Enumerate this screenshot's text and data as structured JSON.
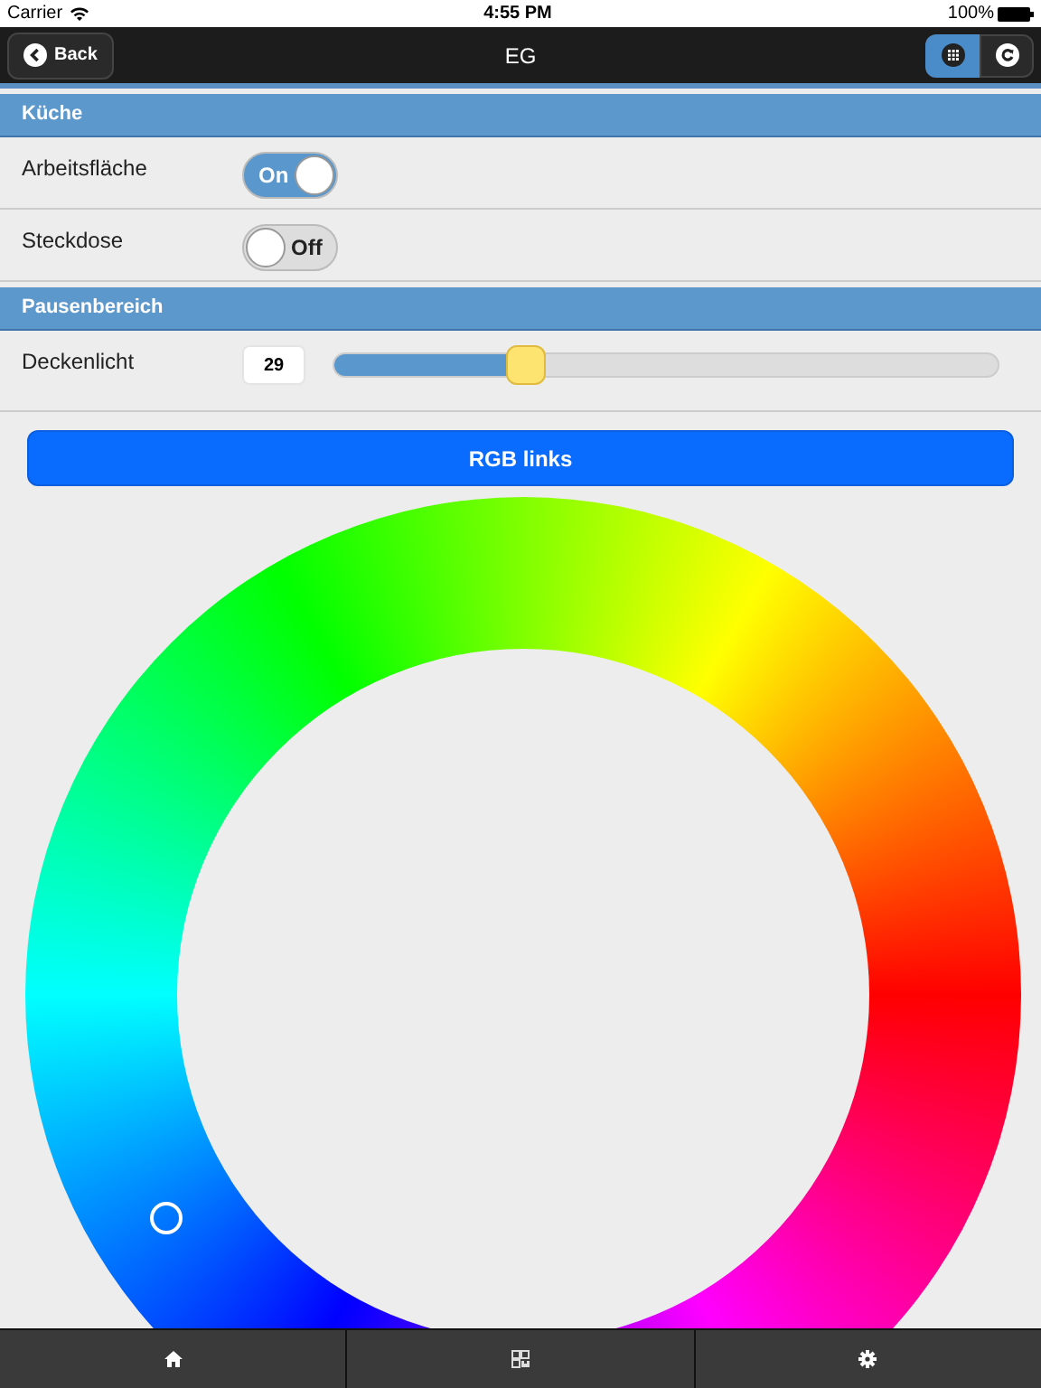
{
  "status_bar": {
    "carrier": "Carrier",
    "time": "4:55 PM",
    "battery": "100%"
  },
  "header": {
    "back": "Back",
    "title": "EG"
  },
  "sections": [
    {
      "title": "Küche",
      "items": [
        {
          "kind": "switch",
          "label": "Arbeitsfläche",
          "on": true,
          "text": "On"
        },
        {
          "kind": "switch",
          "label": "Steckdose",
          "on": false,
          "text": "Off"
        }
      ]
    },
    {
      "title": "Pausenbereich",
      "items": [
        {
          "kind": "slider",
          "label": "Deckenlicht",
          "value": "29",
          "level": 0.29
        }
      ]
    }
  ],
  "color_button": "RGB links",
  "bottom_tabs": [
    {
      "kind": "home"
    },
    {
      "kind": "qr"
    },
    {
      "kind": "gear"
    }
  ]
}
